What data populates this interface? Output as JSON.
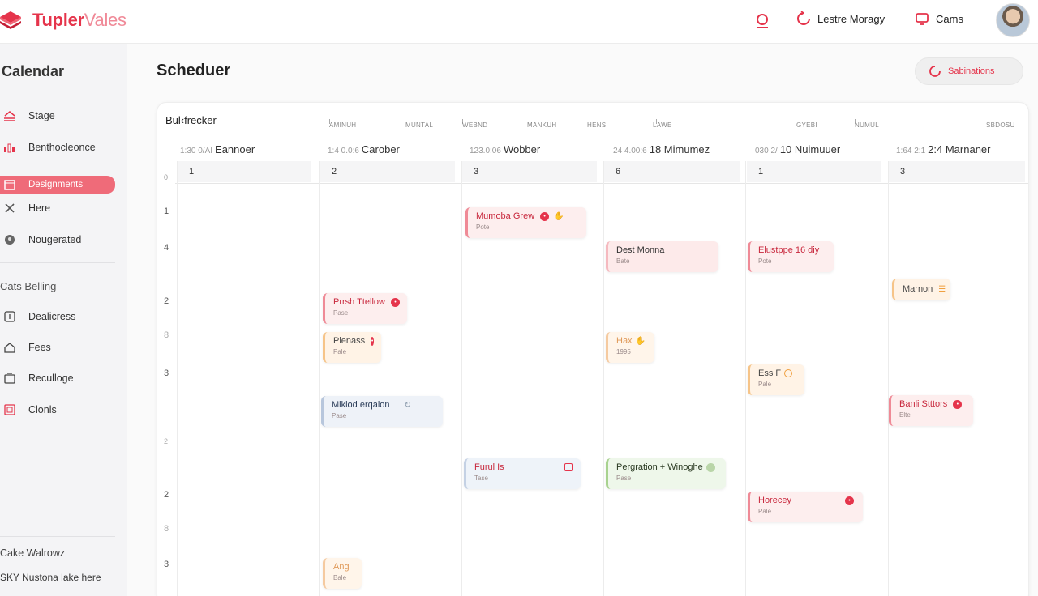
{
  "app": {
    "name_main": "Tupler",
    "name_light": "Vales"
  },
  "topbar": {
    "user_label": "Lestre Moragy",
    "cams_label": "Cams"
  },
  "sidebar": {
    "title": "Calendar",
    "items": [
      {
        "label": "Stage",
        "icon": "tray-icon"
      },
      {
        "label": "Benthocleonce",
        "icon": "chart-icon"
      },
      {
        "label": "Designments",
        "icon": "calendar-icon"
      },
      {
        "label": "Here",
        "icon": "close-icon"
      },
      {
        "label": "Nougerated",
        "icon": "circle-icon"
      }
    ],
    "section_label": "Cats Belling",
    "section_items": [
      {
        "label": "Dealicress",
        "icon": "info-icon"
      },
      {
        "label": "Fees",
        "icon": "home-icon"
      },
      {
        "label": "Reculloge",
        "icon": "folder-icon"
      },
      {
        "label": "Clonls",
        "icon": "grid-icon"
      }
    ],
    "footer_label": "Cake Walrowz",
    "footer_sub": "SKY Nustona lake here"
  },
  "main": {
    "title": "Scheduer",
    "notif_button": "Sabinations"
  },
  "schedule": {
    "title": "Bul‹frecker",
    "ruler_labels": [
      "AMINUH",
      "MUNTAL",
      "WEBND",
      "MANKUH",
      "HENS",
      "LAWE",
      "GYEBI",
      "NUMUL",
      "SBDOSU"
    ],
    "columns": [
      {
        "pre": "1:30 0/AI",
        "name": "Eannoer",
        "num": "1"
      },
      {
        "pre": "1:4 0.0:6",
        "name": "Carober",
        "num": "2"
      },
      {
        "pre": "123.0:06",
        "name": "Wobber",
        "num": "3"
      },
      {
        "pre": "24 4.00:6",
        "name": "18 Mimumez",
        "num": "6"
      },
      {
        "pre": "030 2/",
        "name": "10 Nuimuuer",
        "num": "1"
      },
      {
        "pre": "1:64 2:1",
        "name": "2:4 Marnaner",
        "num": "3"
      }
    ],
    "row_labels": [
      "0",
      "1",
      "4",
      "2",
      "8",
      "3",
      "2",
      "2",
      "8",
      "3"
    ],
    "events": [
      {
        "name": "Mumoba Grew",
        "sub": "Pote",
        "color": "red"
      },
      {
        "name": "Dest Monna",
        "sub": "Bate",
        "color": "pink"
      },
      {
        "name": "Elustppe 16 diy",
        "sub": "Pote",
        "color": "red"
      },
      {
        "name": "Marnon",
        "sub": "",
        "color": "orange"
      },
      {
        "name": "Prrsh Ttellow",
        "sub": "Pase",
        "color": "red"
      },
      {
        "name": "Plenass",
        "sub": "Pale",
        "color": "orange"
      },
      {
        "name": "Hax",
        "sub": "1995",
        "color": "peach"
      },
      {
        "name": "Ess F",
        "sub": "Pale",
        "color": "orange"
      },
      {
        "name": "Mikiod erqalon",
        "sub": "Pase",
        "color": "blue"
      },
      {
        "name": "Banli Stttors",
        "sub": "Elte",
        "color": "red"
      },
      {
        "name": "Furul Is",
        "sub": "Tase",
        "color": "lblue"
      },
      {
        "name": "Pergration + Winoghe",
        "sub": "Pase",
        "color": "green"
      },
      {
        "name": "Horecey",
        "sub": "Pale",
        "color": "red"
      },
      {
        "name": "Ang",
        "sub": "Bale",
        "color": "peach"
      }
    ]
  },
  "colors": {
    "accent": "#e5344b",
    "active_bg": "#ef6b79"
  }
}
